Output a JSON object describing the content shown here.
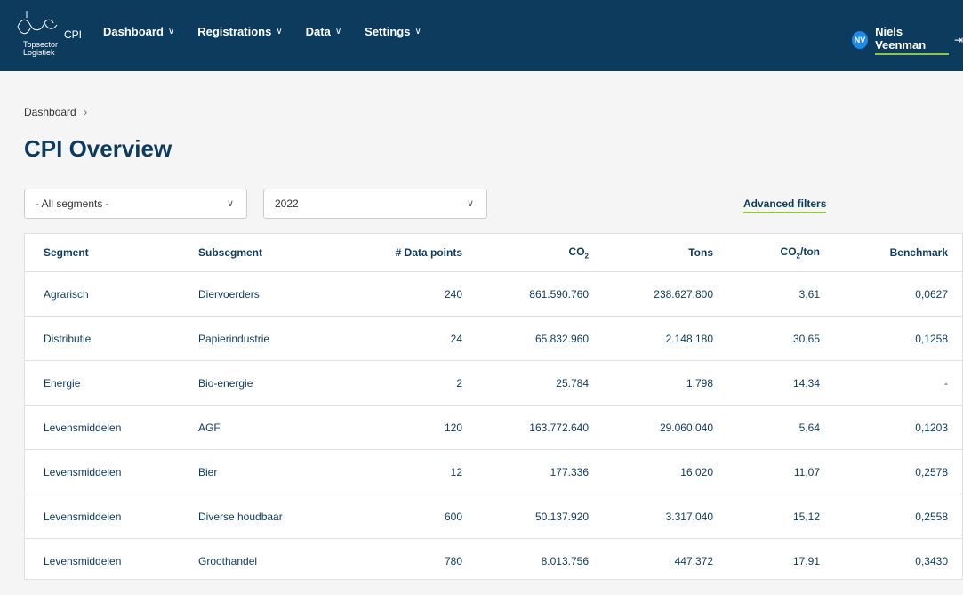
{
  "header": {
    "logo_text_1": "Topsector",
    "logo_text_2": "Logistiek",
    "app_label": "CPI",
    "nav": [
      {
        "label": "Dashboard"
      },
      {
        "label": "Registrations"
      },
      {
        "label": "Data"
      },
      {
        "label": "Settings"
      }
    ],
    "user": {
      "initials": "NV",
      "name": "Niels Veenman"
    }
  },
  "breadcrumb": {
    "item": "Dashboard",
    "separator": "›"
  },
  "page_title": "CPI Overview",
  "filters": {
    "segment_value": "- All segments -",
    "year_value": "2022",
    "advanced_label": "Advanced filters"
  },
  "table": {
    "headers": {
      "segment": "Segment",
      "subsegment": "Subsegment",
      "data_points": "# Data points",
      "co2_prefix": "CO",
      "co2_sub": "2",
      "tons": "Tons",
      "co2ton_prefix": "CO",
      "co2ton_sub": "2",
      "co2ton_suffix": "/ton",
      "benchmark": "Benchmark"
    },
    "rows": [
      {
        "segment": "Agrarisch",
        "subsegment": "Diervoerders",
        "points": "240",
        "co2": "861.590.760",
        "tons": "238.627.800",
        "co2ton": "3,61",
        "benchmark": "0,0627"
      },
      {
        "segment": "Distributie",
        "subsegment": "Papierindustrie",
        "points": "24",
        "co2": "65.832.960",
        "tons": "2.148.180",
        "co2ton": "30,65",
        "benchmark": "0,1258"
      },
      {
        "segment": "Energie",
        "subsegment": "Bio-energie",
        "points": "2",
        "co2": "25.784",
        "tons": "1.798",
        "co2ton": "14,34",
        "benchmark": "-"
      },
      {
        "segment": "Levensmiddelen",
        "subsegment": "AGF",
        "points": "120",
        "co2": "163.772.640",
        "tons": "29.060.040",
        "co2ton": "5,64",
        "benchmark": "0,1203"
      },
      {
        "segment": "Levensmiddelen",
        "subsegment": "Bier",
        "points": "12",
        "co2": "177.336",
        "tons": "16.020",
        "co2ton": "11,07",
        "benchmark": "0,2578"
      },
      {
        "segment": "Levensmiddelen",
        "subsegment": "Diverse houdbaar",
        "points": "600",
        "co2": "50.137.920",
        "tons": "3.317.040",
        "co2ton": "15,12",
        "benchmark": "0,2558"
      },
      {
        "segment": "Levensmiddelen",
        "subsegment": "Groothandel",
        "points": "780",
        "co2": "8.013.756",
        "tons": "447.372",
        "co2ton": "17,91",
        "benchmark": "0,3430"
      }
    ]
  },
  "colors": {
    "nav_bg": "#0d3b5e",
    "accent": "#8dc63f",
    "avatar": "#1e88e5"
  }
}
